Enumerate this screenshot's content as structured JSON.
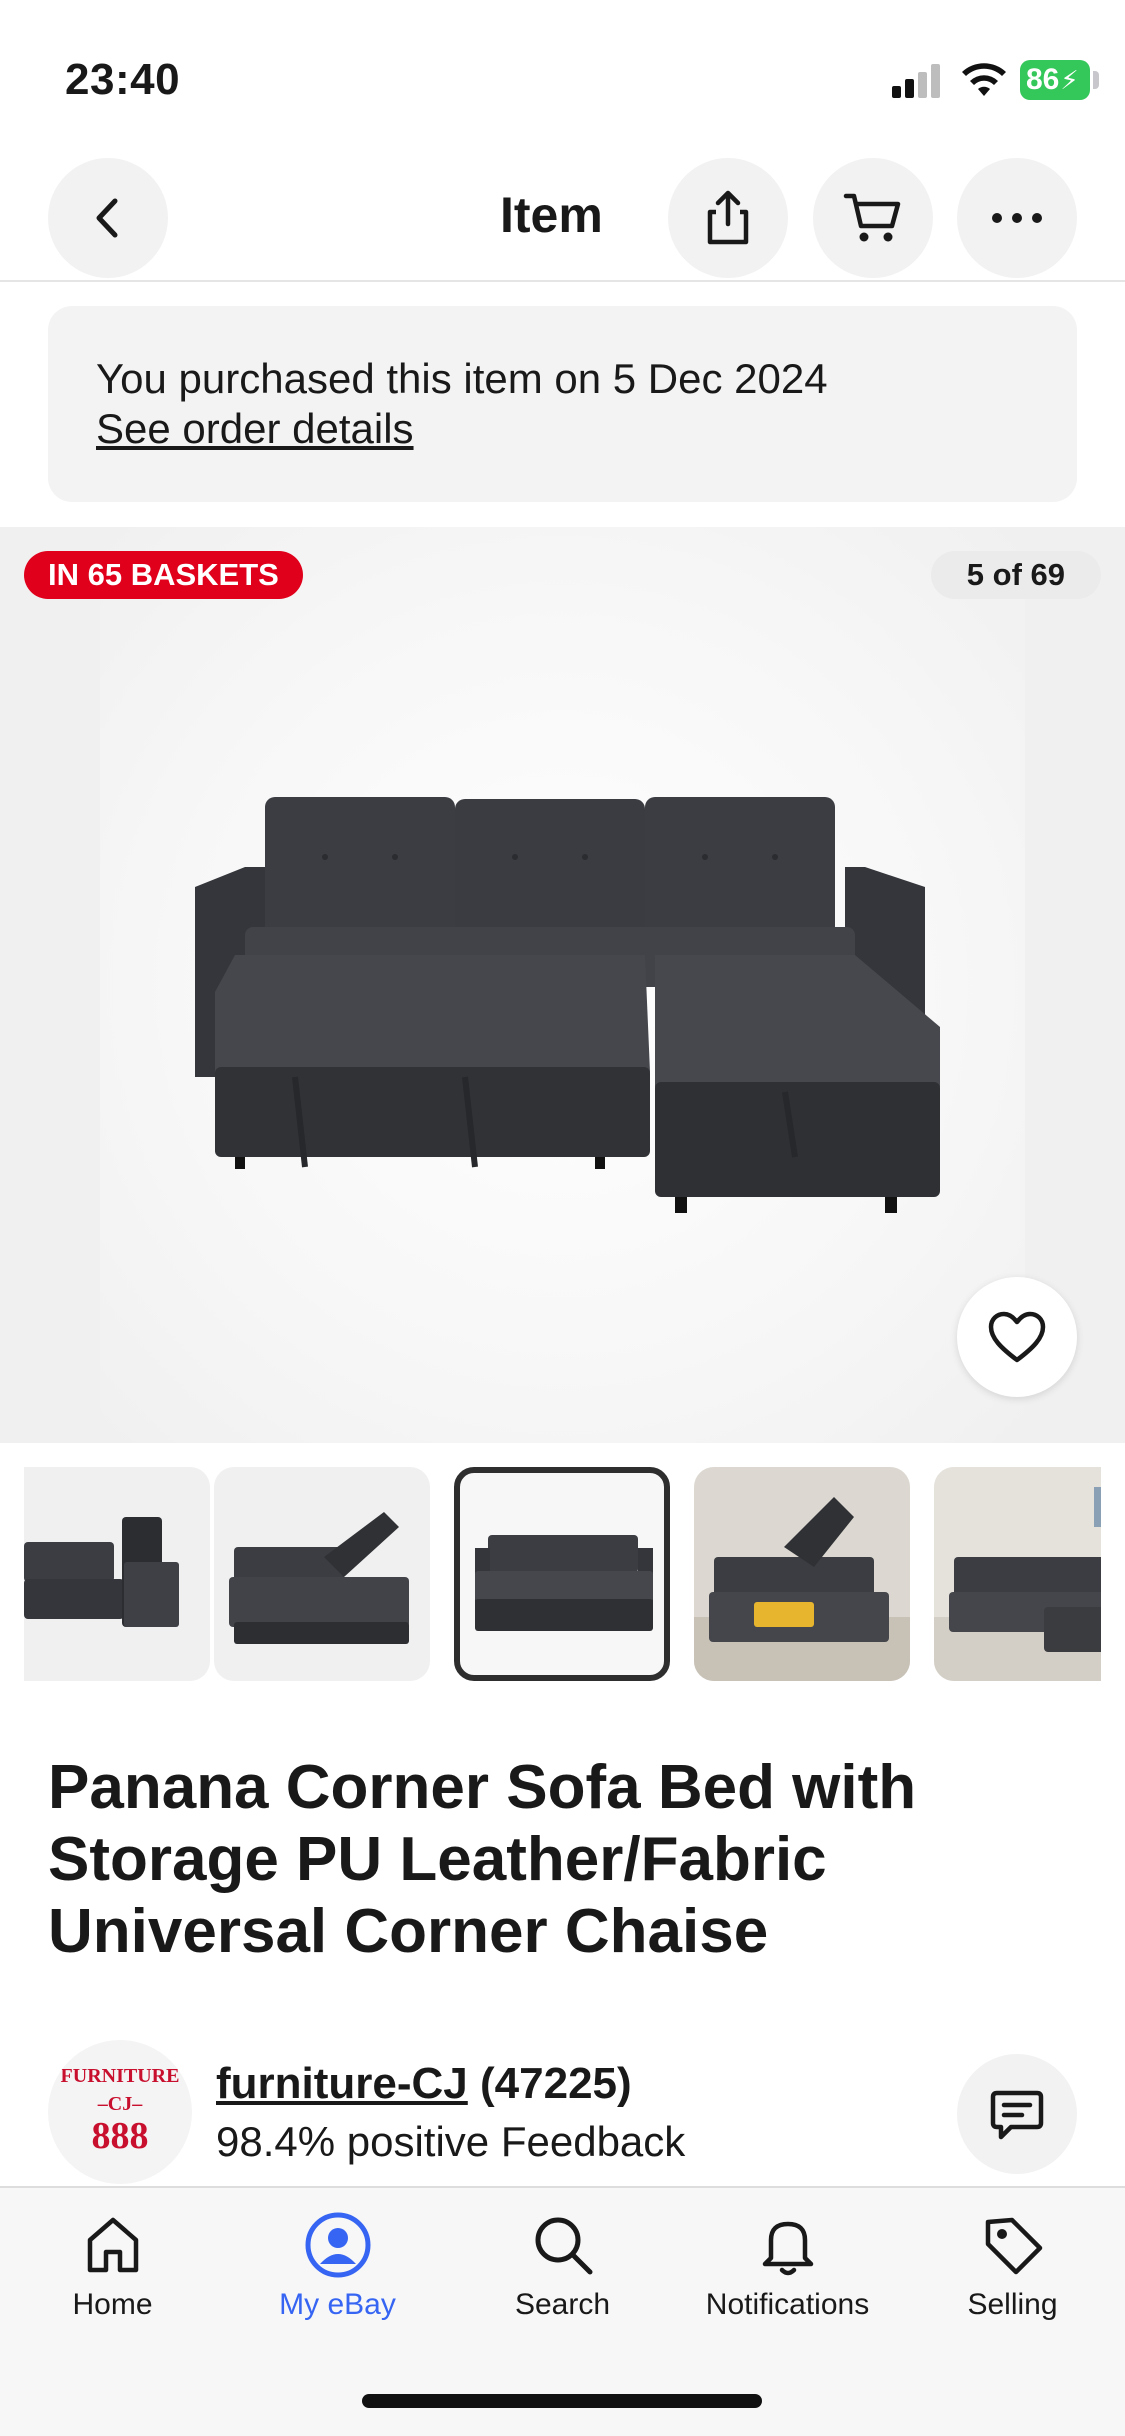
{
  "status_bar": {
    "time": "23:40",
    "battery": "86",
    "icons": [
      "signal-icon",
      "wifi-icon",
      "battery-charging-icon"
    ]
  },
  "nav": {
    "title": "Item",
    "icons": [
      "back-arrow-icon",
      "share-icon",
      "cart-icon",
      "more-icon"
    ]
  },
  "banner": {
    "text": "You purchased this item on 5 Dec 2024",
    "link": "See order details"
  },
  "gallery": {
    "badge": "IN 65 BASKETS",
    "counter": "5 of 69",
    "current_index": 5,
    "total": 69,
    "favorite_icon": "heart-outline-icon"
  },
  "thumbnails": [
    {
      "name": "thumb-storage-chaise",
      "active": false
    },
    {
      "name": "thumb-sofa-open-storage",
      "active": false
    },
    {
      "name": "thumb-sofa-bed",
      "active": true
    },
    {
      "name": "thumb-room-storage-open",
      "active": false
    },
    {
      "name": "thumb-room-sofa",
      "active": false
    }
  ],
  "item": {
    "title": "Panana Corner Sofa Bed with Storage PU Leather/Fabric Universal Corner Chaise"
  },
  "seller": {
    "logo_lines": [
      "FURNITURE",
      "–CJ–",
      "888"
    ],
    "name": "furniture-CJ",
    "count": "(47225)",
    "feedback": "98.4% positive Feedback",
    "message_icon": "message-icon"
  },
  "tabbar": {
    "active": "My eBay",
    "accent": "#3665f3",
    "items": [
      {
        "label": "Home",
        "icon": "home-icon"
      },
      {
        "label": "My eBay",
        "icon": "profile-icon"
      },
      {
        "label": "Search",
        "icon": "search-icon"
      },
      {
        "label": "Notifications",
        "icon": "bell-icon"
      },
      {
        "label": "Selling",
        "icon": "tag-icon"
      }
    ]
  },
  "colors": {
    "badge": "#e0001b",
    "battery": "#34c759",
    "link_active": "#3665f3"
  }
}
